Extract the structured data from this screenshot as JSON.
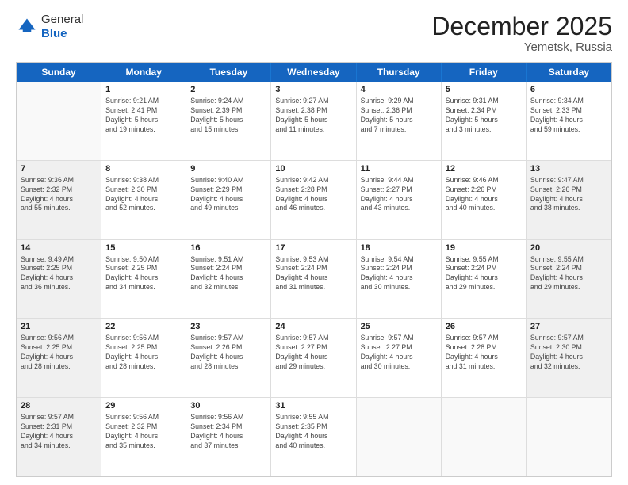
{
  "logo": {
    "general": "General",
    "blue": "Blue"
  },
  "title": "December 2025",
  "subtitle": "Yemetsk, Russia",
  "header_days": [
    "Sunday",
    "Monday",
    "Tuesday",
    "Wednesday",
    "Thursday",
    "Friday",
    "Saturday"
  ],
  "weeks": [
    [
      {
        "day": "",
        "info": "",
        "empty": true
      },
      {
        "day": "1",
        "info": "Sunrise: 9:21 AM\nSunset: 2:41 PM\nDaylight: 5 hours\nand 19 minutes."
      },
      {
        "day": "2",
        "info": "Sunrise: 9:24 AM\nSunset: 2:39 PM\nDaylight: 5 hours\nand 15 minutes."
      },
      {
        "day": "3",
        "info": "Sunrise: 9:27 AM\nSunset: 2:38 PM\nDaylight: 5 hours\nand 11 minutes."
      },
      {
        "day": "4",
        "info": "Sunrise: 9:29 AM\nSunset: 2:36 PM\nDaylight: 5 hours\nand 7 minutes."
      },
      {
        "day": "5",
        "info": "Sunrise: 9:31 AM\nSunset: 2:34 PM\nDaylight: 5 hours\nand 3 minutes."
      },
      {
        "day": "6",
        "info": "Sunrise: 9:34 AM\nSunset: 2:33 PM\nDaylight: 4 hours\nand 59 minutes."
      }
    ],
    [
      {
        "day": "7",
        "info": "Sunrise: 9:36 AM\nSunset: 2:32 PM\nDaylight: 4 hours\nand 55 minutes.",
        "shaded": true
      },
      {
        "day": "8",
        "info": "Sunrise: 9:38 AM\nSunset: 2:30 PM\nDaylight: 4 hours\nand 52 minutes."
      },
      {
        "day": "9",
        "info": "Sunrise: 9:40 AM\nSunset: 2:29 PM\nDaylight: 4 hours\nand 49 minutes."
      },
      {
        "day": "10",
        "info": "Sunrise: 9:42 AM\nSunset: 2:28 PM\nDaylight: 4 hours\nand 46 minutes."
      },
      {
        "day": "11",
        "info": "Sunrise: 9:44 AM\nSunset: 2:27 PM\nDaylight: 4 hours\nand 43 minutes."
      },
      {
        "day": "12",
        "info": "Sunrise: 9:46 AM\nSunset: 2:26 PM\nDaylight: 4 hours\nand 40 minutes."
      },
      {
        "day": "13",
        "info": "Sunrise: 9:47 AM\nSunset: 2:26 PM\nDaylight: 4 hours\nand 38 minutes.",
        "shaded": true
      }
    ],
    [
      {
        "day": "14",
        "info": "Sunrise: 9:49 AM\nSunset: 2:25 PM\nDaylight: 4 hours\nand 36 minutes.",
        "shaded": true
      },
      {
        "day": "15",
        "info": "Sunrise: 9:50 AM\nSunset: 2:25 PM\nDaylight: 4 hours\nand 34 minutes."
      },
      {
        "day": "16",
        "info": "Sunrise: 9:51 AM\nSunset: 2:24 PM\nDaylight: 4 hours\nand 32 minutes."
      },
      {
        "day": "17",
        "info": "Sunrise: 9:53 AM\nSunset: 2:24 PM\nDaylight: 4 hours\nand 31 minutes."
      },
      {
        "day": "18",
        "info": "Sunrise: 9:54 AM\nSunset: 2:24 PM\nDaylight: 4 hours\nand 30 minutes."
      },
      {
        "day": "19",
        "info": "Sunrise: 9:55 AM\nSunset: 2:24 PM\nDaylight: 4 hours\nand 29 minutes."
      },
      {
        "day": "20",
        "info": "Sunrise: 9:55 AM\nSunset: 2:24 PM\nDaylight: 4 hours\nand 29 minutes.",
        "shaded": true
      }
    ],
    [
      {
        "day": "21",
        "info": "Sunrise: 9:56 AM\nSunset: 2:25 PM\nDaylight: 4 hours\nand 28 minutes.",
        "shaded": true
      },
      {
        "day": "22",
        "info": "Sunrise: 9:56 AM\nSunset: 2:25 PM\nDaylight: 4 hours\nand 28 minutes."
      },
      {
        "day": "23",
        "info": "Sunrise: 9:57 AM\nSunset: 2:26 PM\nDaylight: 4 hours\nand 28 minutes."
      },
      {
        "day": "24",
        "info": "Sunrise: 9:57 AM\nSunset: 2:27 PM\nDaylight: 4 hours\nand 29 minutes."
      },
      {
        "day": "25",
        "info": "Sunrise: 9:57 AM\nSunset: 2:27 PM\nDaylight: 4 hours\nand 30 minutes."
      },
      {
        "day": "26",
        "info": "Sunrise: 9:57 AM\nSunset: 2:28 PM\nDaylight: 4 hours\nand 31 minutes."
      },
      {
        "day": "27",
        "info": "Sunrise: 9:57 AM\nSunset: 2:30 PM\nDaylight: 4 hours\nand 32 minutes.",
        "shaded": true
      }
    ],
    [
      {
        "day": "28",
        "info": "Sunrise: 9:57 AM\nSunset: 2:31 PM\nDaylight: 4 hours\nand 34 minutes.",
        "shaded": true
      },
      {
        "day": "29",
        "info": "Sunrise: 9:56 AM\nSunset: 2:32 PM\nDaylight: 4 hours\nand 35 minutes."
      },
      {
        "day": "30",
        "info": "Sunrise: 9:56 AM\nSunset: 2:34 PM\nDaylight: 4 hours\nand 37 minutes."
      },
      {
        "day": "31",
        "info": "Sunrise: 9:55 AM\nSunset: 2:35 PM\nDaylight: 4 hours\nand 40 minutes."
      },
      {
        "day": "",
        "info": "",
        "empty": true
      },
      {
        "day": "",
        "info": "",
        "empty": true
      },
      {
        "day": "",
        "info": "",
        "empty": true
      }
    ]
  ]
}
